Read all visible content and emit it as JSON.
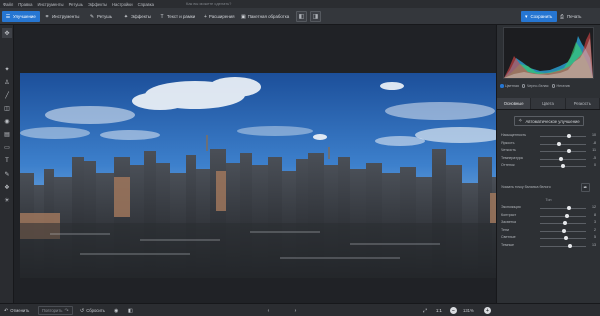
{
  "menu": {
    "items": [
      "Файл",
      "Правка",
      "Инструменты",
      "Ретушь",
      "Эффекты",
      "Настройки",
      "Справка"
    ],
    "help_placeholder": "Как вы можете сделать?"
  },
  "toolbar": {
    "tabs": [
      {
        "label": "Улучшение",
        "icon": "sliders-icon",
        "active": true
      },
      {
        "label": "Инструменты",
        "icon": "crop-icon",
        "active": false
      },
      {
        "label": "Ретушь",
        "icon": "brush-icon",
        "active": false
      },
      {
        "label": "Эффекты",
        "icon": "sparkle-icon",
        "active": false
      },
      {
        "label": "Текст и рамки",
        "icon": "text-icon",
        "active": false
      },
      {
        "label": "Расширения",
        "icon": "plus-icon",
        "active": false
      },
      {
        "label": "Пакетная обработка",
        "icon": "batch-icon",
        "active": false
      }
    ],
    "save_label": "Сохранить",
    "print_label": "Печать"
  },
  "tools": [
    {
      "name": "move-tool-icon",
      "glyph": "✥"
    },
    {
      "name": "magic-wand-tool-icon",
      "glyph": "✦"
    },
    {
      "name": "stamp-tool-icon",
      "glyph": "♙"
    },
    {
      "name": "brush-tool-icon",
      "glyph": "╱"
    },
    {
      "name": "eraser-tool-icon",
      "glyph": "◫"
    },
    {
      "name": "radial-tool-icon",
      "glyph": "◉"
    },
    {
      "name": "gradient-tool-icon",
      "glyph": "▤"
    },
    {
      "name": "frame-tool-icon",
      "glyph": "▭"
    },
    {
      "name": "text-tool-icon",
      "glyph": "T"
    },
    {
      "name": "pen-tool-icon",
      "glyph": "✎"
    },
    {
      "name": "layers-tool-icon",
      "glyph": "❖"
    },
    {
      "name": "light-tool-icon",
      "glyph": "☀"
    }
  ],
  "panel": {
    "histogram_modes": [
      {
        "label": "Цветная",
        "selected": true
      },
      {
        "label": "Черно-белая",
        "selected": false
      },
      {
        "label": "Негатив",
        "selected": false
      }
    ],
    "tabs": [
      {
        "label": "Основные",
        "active": true
      },
      {
        "label": "Цвета",
        "active": false
      },
      {
        "label": "Резкость",
        "active": false
      }
    ],
    "auto_button": "Автоматическое улучшение",
    "color_sliders": [
      {
        "label": "Насыщенность",
        "value": "10",
        "fraction": 0.62
      },
      {
        "label": "Яркость",
        "value": "-8",
        "fraction": 0.42
      },
      {
        "label": "Четкость",
        "value": "11",
        "fraction": 0.63
      },
      {
        "label": "Температура",
        "value": "-5",
        "fraction": 0.46
      },
      {
        "label": "Оттенок",
        "value": "0",
        "fraction": 0.5
      }
    ],
    "white_balance_label": "Указать точку баланса белого",
    "tone_section": "Тон",
    "tone_sliders": [
      {
        "label": "Экспозиция",
        "value": "12",
        "fraction": 0.64
      },
      {
        "label": "Контраст",
        "value": "8",
        "fraction": 0.59
      },
      {
        "label": "Засветка",
        "value": "3",
        "fraction": 0.54
      },
      {
        "label": "Тени",
        "value": "2",
        "fraction": 0.53
      },
      {
        "label": "Светлые",
        "value": "5",
        "fraction": 0.56
      },
      {
        "label": "Темные",
        "value": "13",
        "fraction": 0.66
      }
    ]
  },
  "bottom": {
    "undo_label": "Отменить",
    "redo_label": "Повторить",
    "reset_label": "Сбросить",
    "zoom_ratio": "1:1",
    "zoom_level": "131%"
  },
  "colors": {
    "accent": "#2676d2",
    "background": "#1f2125",
    "panel": "#2d3034"
  }
}
